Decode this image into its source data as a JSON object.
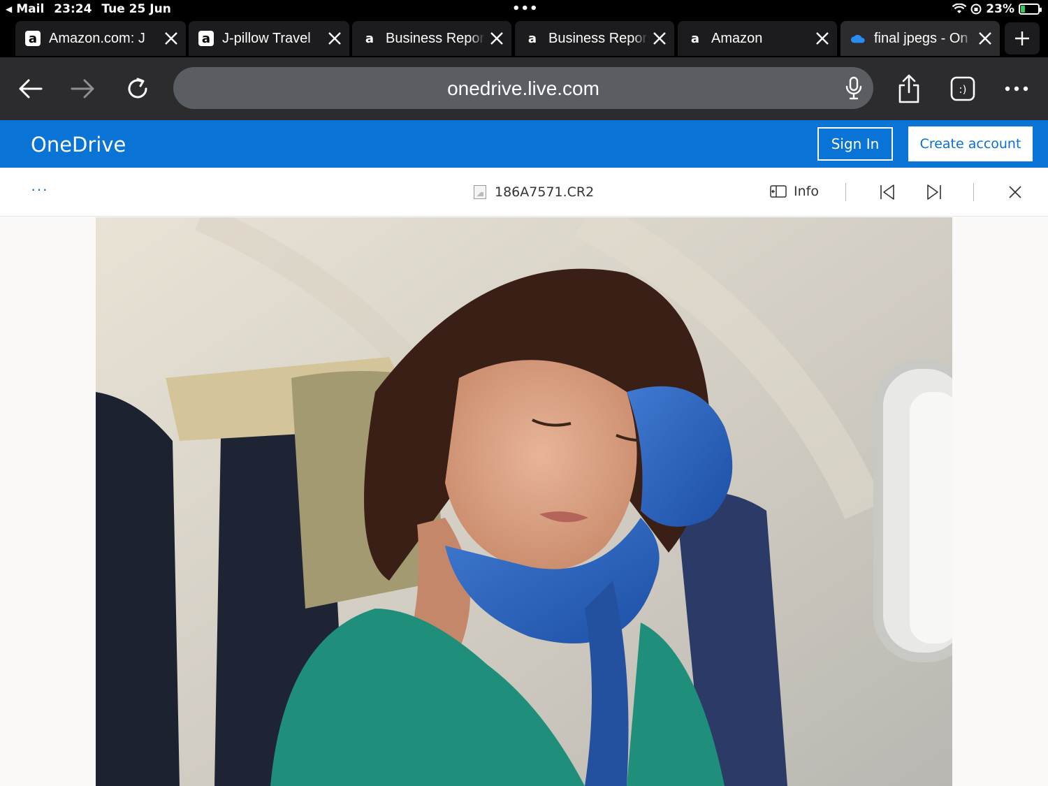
{
  "status_bar": {
    "back_app": "Mail",
    "time": "23:24",
    "date": "Tue 25 Jun",
    "battery": "23%",
    "battery_level": 0.23
  },
  "tabs": [
    {
      "favicon": "amazon-icon",
      "title": "Amazon.com: J",
      "active": false
    },
    {
      "favicon": "amazon-icon",
      "title": "J-pillow Travel",
      "active": false
    },
    {
      "favicon": "amazon-icon",
      "title": "Business Repor",
      "active": false
    },
    {
      "favicon": "amazon-icon",
      "title": "Business Repor",
      "active": false
    },
    {
      "favicon": "amazon-icon",
      "title": "Amazon",
      "active": false
    },
    {
      "favicon": "onedrive-cloud-icon",
      "title": "final jpegs - On",
      "active": true
    }
  ],
  "browser": {
    "url": "onedrive.live.com"
  },
  "onedrive": {
    "brand": "OneDrive",
    "sign_in": "Sign In",
    "create_account": "Create account",
    "accent_color": "#0a74d6"
  },
  "viewer": {
    "more": "···",
    "file_name": "186A7571.CR2",
    "info_label": "Info"
  }
}
